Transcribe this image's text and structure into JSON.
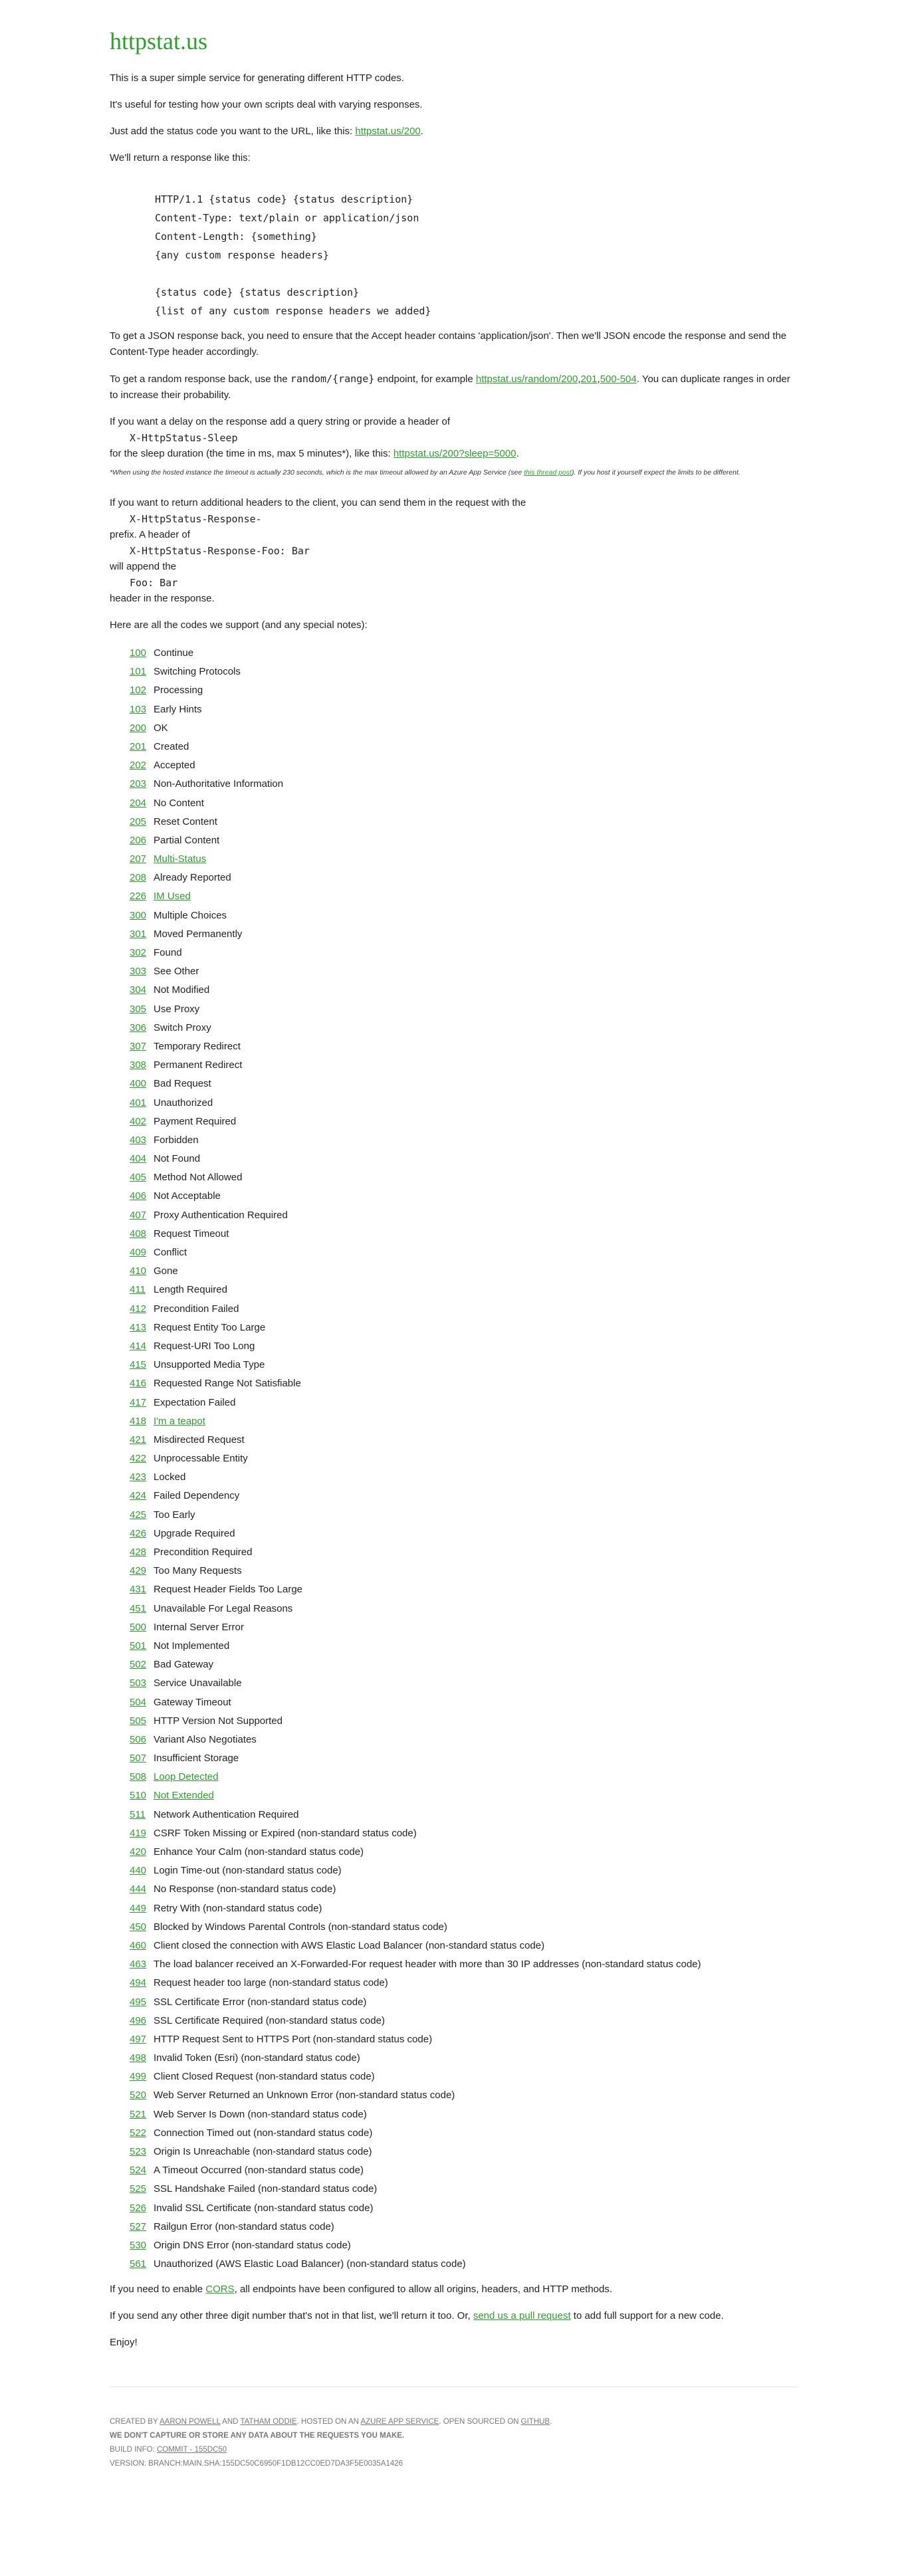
{
  "title": "httpstat.us",
  "intro": {
    "p1": "This is a super simple service for generating different HTTP codes.",
    "p2": "It's useful for testing how your own scripts deal with varying responses.",
    "p3_before": "Just add the status code you want to the URL, like this: ",
    "p3_link": "httpstat.us/200",
    "p3_after": ".",
    "p4": "We'll return a response like this:"
  },
  "response_example": "HTTP/1.1 {status code} {status description}\nContent-Type: text/plain or application/json\nContent-Length: {something}\n{any custom response headers}\n\n{status code} {status description}\n{list of any custom response headers we added}",
  "json_note": "To get a JSON response back, you need to ensure that the Accept header contains 'application/json'. Then we'll JSON encode the response and send the Content-Type header accordingly.",
  "random": {
    "before": "To get a random response back, use the ",
    "code": "random/{range}",
    "middle": " endpoint, for example ",
    "link1": "httpstat.us/random/200",
    "sep1": ",",
    "link2": "201",
    "sep2": ",",
    "link3": "500-504",
    "after": ". You can duplicate ranges in order to increase their probability."
  },
  "sleep": {
    "before": "If you want a delay on the response add a query string or provide a header of",
    "header": "X-HttpStatus-Sleep",
    "after_before_link": "for the sleep duration (the time in ms, max 5 minutes*), like this: ",
    "link": "httpstat.us/200?sleep=5000",
    "after": ".",
    "note_before": "*When using the hosted instance the timeout is actually 230 seconds, which is the max timeout allowed by an Azure App Service (see ",
    "note_link": "this thread post",
    "note_after": "). If you host it yourself expect the limits to be different."
  },
  "headers": {
    "line1": "If you want to return additional headers to the client, you can send them in the request with the",
    "code1": "X-HttpStatus-Response-",
    "line2": "prefix. A header of",
    "code2": "X-HttpStatus-Response-Foo: Bar",
    "line3": "will append the",
    "code3": "Foo: Bar",
    "line4": "header in the response."
  },
  "codes_intro": "Here are all the codes we support (and any special notes):",
  "codes": [
    {
      "code": "100",
      "desc": "Continue",
      "desc_link": false
    },
    {
      "code": "101",
      "desc": "Switching Protocols",
      "desc_link": false
    },
    {
      "code": "102",
      "desc": "Processing",
      "desc_link": false
    },
    {
      "code": "103",
      "desc": "Early Hints",
      "desc_link": false
    },
    {
      "code": "200",
      "desc": "OK",
      "desc_link": false
    },
    {
      "code": "201",
      "desc": "Created",
      "desc_link": false
    },
    {
      "code": "202",
      "desc": "Accepted",
      "desc_link": false
    },
    {
      "code": "203",
      "desc": "Non-Authoritative Information",
      "desc_link": false
    },
    {
      "code": "204",
      "desc": "No Content",
      "desc_link": false
    },
    {
      "code": "205",
      "desc": "Reset Content",
      "desc_link": false
    },
    {
      "code": "206",
      "desc": "Partial Content",
      "desc_link": false
    },
    {
      "code": "207",
      "desc": "Multi-Status",
      "desc_link": true
    },
    {
      "code": "208",
      "desc": "Already Reported",
      "desc_link": false
    },
    {
      "code": "226",
      "desc": "IM Used",
      "desc_link": true
    },
    {
      "code": "300",
      "desc": "Multiple Choices",
      "desc_link": false
    },
    {
      "code": "301",
      "desc": "Moved Permanently",
      "desc_link": false
    },
    {
      "code": "302",
      "desc": "Found",
      "desc_link": false
    },
    {
      "code": "303",
      "desc": "See Other",
      "desc_link": false
    },
    {
      "code": "304",
      "desc": "Not Modified",
      "desc_link": false
    },
    {
      "code": "305",
      "desc": "Use Proxy",
      "desc_link": false
    },
    {
      "code": "306",
      "desc": "Switch Proxy",
      "desc_link": false
    },
    {
      "code": "307",
      "desc": "Temporary Redirect",
      "desc_link": false
    },
    {
      "code": "308",
      "desc": "Permanent Redirect",
      "desc_link": false
    },
    {
      "code": "400",
      "desc": "Bad Request",
      "desc_link": false
    },
    {
      "code": "401",
      "desc": "Unauthorized",
      "desc_link": false
    },
    {
      "code": "402",
      "desc": "Payment Required",
      "desc_link": false
    },
    {
      "code": "403",
      "desc": "Forbidden",
      "desc_link": false
    },
    {
      "code": "404",
      "desc": "Not Found",
      "desc_link": false
    },
    {
      "code": "405",
      "desc": "Method Not Allowed",
      "desc_link": false
    },
    {
      "code": "406",
      "desc": "Not Acceptable",
      "desc_link": false
    },
    {
      "code": "407",
      "desc": "Proxy Authentication Required",
      "desc_link": false
    },
    {
      "code": "408",
      "desc": "Request Timeout",
      "desc_link": false
    },
    {
      "code": "409",
      "desc": "Conflict",
      "desc_link": false
    },
    {
      "code": "410",
      "desc": "Gone",
      "desc_link": false
    },
    {
      "code": "411",
      "desc": "Length Required",
      "desc_link": false
    },
    {
      "code": "412",
      "desc": "Precondition Failed",
      "desc_link": false
    },
    {
      "code": "413",
      "desc": "Request Entity Too Large",
      "desc_link": false
    },
    {
      "code": "414",
      "desc": "Request-URI Too Long",
      "desc_link": false
    },
    {
      "code": "415",
      "desc": "Unsupported Media Type",
      "desc_link": false
    },
    {
      "code": "416",
      "desc": "Requested Range Not Satisfiable",
      "desc_link": false
    },
    {
      "code": "417",
      "desc": "Expectation Failed",
      "desc_link": false
    },
    {
      "code": "418",
      "desc": "I'm a teapot",
      "desc_link": true
    },
    {
      "code": "421",
      "desc": "Misdirected Request",
      "desc_link": false
    },
    {
      "code": "422",
      "desc": "Unprocessable Entity",
      "desc_link": false
    },
    {
      "code": "423",
      "desc": "Locked",
      "desc_link": false
    },
    {
      "code": "424",
      "desc": "Failed Dependency",
      "desc_link": false
    },
    {
      "code": "425",
      "desc": "Too Early",
      "desc_link": false
    },
    {
      "code": "426",
      "desc": "Upgrade Required",
      "desc_link": false
    },
    {
      "code": "428",
      "desc": "Precondition Required",
      "desc_link": false
    },
    {
      "code": "429",
      "desc": "Too Many Requests",
      "desc_link": false
    },
    {
      "code": "431",
      "desc": "Request Header Fields Too Large",
      "desc_link": false
    },
    {
      "code": "451",
      "desc": "Unavailable For Legal Reasons",
      "desc_link": false
    },
    {
      "code": "500",
      "desc": "Internal Server Error",
      "desc_link": false
    },
    {
      "code": "501",
      "desc": "Not Implemented",
      "desc_link": false
    },
    {
      "code": "502",
      "desc": "Bad Gateway",
      "desc_link": false
    },
    {
      "code": "503",
      "desc": "Service Unavailable",
      "desc_link": false
    },
    {
      "code": "504",
      "desc": "Gateway Timeout",
      "desc_link": false
    },
    {
      "code": "505",
      "desc": "HTTP Version Not Supported",
      "desc_link": false
    },
    {
      "code": "506",
      "desc": "Variant Also Negotiates",
      "desc_link": false
    },
    {
      "code": "507",
      "desc": "Insufficient Storage",
      "desc_link": false
    },
    {
      "code": "508",
      "desc": "Loop Detected",
      "desc_link": true
    },
    {
      "code": "510",
      "desc": "Not Extended",
      "desc_link": true
    },
    {
      "code": "511",
      "desc": "Network Authentication Required",
      "desc_link": false
    },
    {
      "code": "419",
      "desc": "CSRF Token Missing or Expired (non-standard status code)",
      "desc_link": false
    },
    {
      "code": "420",
      "desc": "Enhance Your Calm (non-standard status code)",
      "desc_link": false
    },
    {
      "code": "440",
      "desc": "Login Time-out (non-standard status code)",
      "desc_link": false
    },
    {
      "code": "444",
      "desc": "No Response (non-standard status code)",
      "desc_link": false
    },
    {
      "code": "449",
      "desc": "Retry With (non-standard status code)",
      "desc_link": false
    },
    {
      "code": "450",
      "desc": "Blocked by Windows Parental Controls (non-standard status code)",
      "desc_link": false
    },
    {
      "code": "460",
      "desc": "Client closed the connection with AWS Elastic Load Balancer (non-standard status code)",
      "desc_link": false
    },
    {
      "code": "463",
      "desc": "The load balancer received an X-Forwarded-For request header with more than 30 IP addresses (non-standard status code)",
      "desc_link": false
    },
    {
      "code": "494",
      "desc": "Request header too large (non-standard status code)",
      "desc_link": false
    },
    {
      "code": "495",
      "desc": "SSL Certificate Error (non-standard status code)",
      "desc_link": false
    },
    {
      "code": "496",
      "desc": "SSL Certificate Required (non-standard status code)",
      "desc_link": false
    },
    {
      "code": "497",
      "desc": "HTTP Request Sent to HTTPS Port (non-standard status code)",
      "desc_link": false
    },
    {
      "code": "498",
      "desc": "Invalid Token (Esri) (non-standard status code)",
      "desc_link": false
    },
    {
      "code": "499",
      "desc": "Client Closed Request (non-standard status code)",
      "desc_link": false
    },
    {
      "code": "520",
      "desc": "Web Server Returned an Unknown Error (non-standard status code)",
      "desc_link": false
    },
    {
      "code": "521",
      "desc": "Web Server Is Down (non-standard status code)",
      "desc_link": false
    },
    {
      "code": "522",
      "desc": "Connection Timed out (non-standard status code)",
      "desc_link": false
    },
    {
      "code": "523",
      "desc": "Origin Is Unreachable (non-standard status code)",
      "desc_link": false
    },
    {
      "code": "524",
      "desc": "A Timeout Occurred (non-standard status code)",
      "desc_link": false
    },
    {
      "code": "525",
      "desc": "SSL Handshake Failed (non-standard status code)",
      "desc_link": false
    },
    {
      "code": "526",
      "desc": "Invalid SSL Certificate (non-standard status code)",
      "desc_link": false
    },
    {
      "code": "527",
      "desc": "Railgun Error (non-standard status code)",
      "desc_link": false
    },
    {
      "code": "530",
      "desc": "Origin DNS Error (non-standard status code)",
      "desc_link": false
    },
    {
      "code": "561",
      "desc": "Unauthorized (AWS Elastic Load Balancer) (non-standard status code)",
      "desc_link": false
    }
  ],
  "cors": {
    "before": "If you need to enable ",
    "link": "CORS",
    "after": ", all endpoints have been configured to allow all origins, headers, and HTTP methods."
  },
  "other": {
    "before": "If you send any other three digit number that's not in that list, we'll return it too. Or, ",
    "link": "send us a pull request",
    "after": " to add full support for a new code."
  },
  "enjoy": "Enjoy!",
  "footer": {
    "created_by": "Created by ",
    "author1": "Aaron Powell",
    "and": " and ",
    "author2": "Tatham Oddie",
    "hosted": ". Hosted on an ",
    "host_link": "Azure App Service",
    "open": ". Open sourced on ",
    "github_link": "GitHub",
    "end": ".",
    "privacy": "We don't capture or store any data about the requests you make.",
    "build_label": "Build info: ",
    "build_link": "Commit - 155DC50",
    "version": "Version: BRANCH:MAIN.SHA:155DC50C6950F1DB12CC0ED7DA3F5E0035A1426"
  },
  "colors": {
    "accent": "#2e9e2e",
    "text": "#222222",
    "muted": "#777777"
  }
}
